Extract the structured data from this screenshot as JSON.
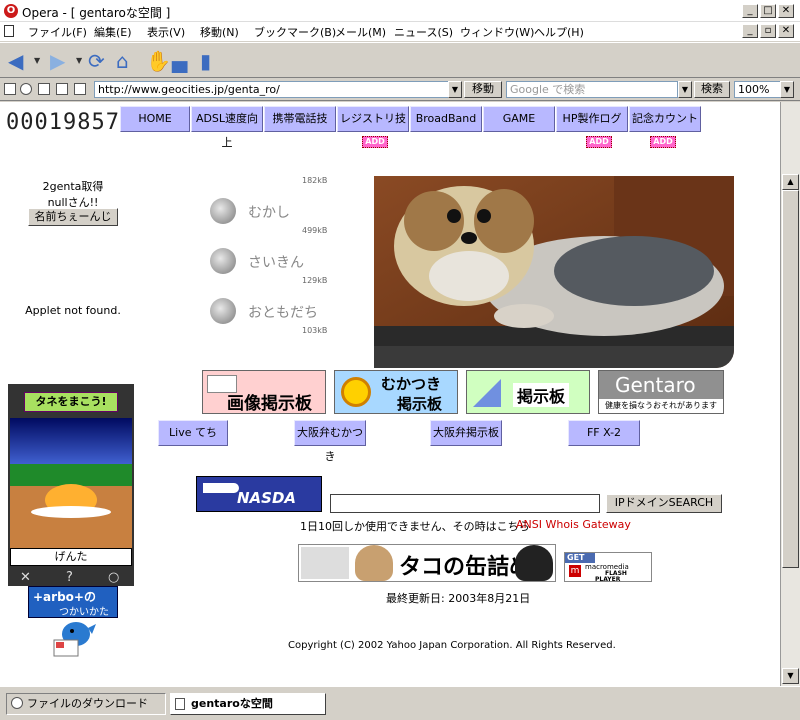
{
  "window": {
    "title": "Opera - [ gentaroな空間 ]"
  },
  "menu": [
    "ファイル(F)",
    "編集(E)",
    "表示(V)",
    "移動(N)",
    "ブックマーク(B)",
    "メール(M)",
    "ニュース(S)",
    "ウィンドウ(W)",
    "ヘルプ(H)"
  ],
  "address": {
    "url": "http://www.geocities.jp/genta_ro/",
    "go_label": "移動",
    "search_placeholder": "Google で検索",
    "search_label": "検索",
    "zoom": "100%"
  },
  "page": {
    "counter": "00019857",
    "nav": [
      "HOME",
      "ADSL速度向上",
      "携帯電話技",
      "レジストリ技",
      "BroadBand",
      "GAME",
      "HP製作ログ",
      "記念カウント"
    ],
    "add_badge": "ADD",
    "left": {
      "line1": "2genta取得",
      "line2": "nullさん!!",
      "name_button": "名前ちぇーんじ",
      "applet": "Applet not found."
    },
    "sounds": [
      {
        "size": "182kB",
        "label": ""
      },
      {
        "size": "499kB",
        "label": "むかし"
      },
      {
        "size": "129kB",
        "label": "さいきん"
      },
      {
        "size": "103kB",
        "label": "おともだち"
      }
    ],
    "banners": {
      "b1": "画像掲示板",
      "b2a": "むかつき",
      "b2b": "掲示板",
      "b3": "掲示板",
      "b4a": "Gentaro",
      "b4b": "健康を損なうおそれがあります"
    },
    "links": [
      "Live てち",
      "大阪弁むかつき",
      "大阪弁掲示板",
      "FF X-2"
    ],
    "tarbo": {
      "label": "タネをまこう!",
      "name": "げんた",
      "ctrl": [
        "✕",
        "?",
        "○"
      ],
      "howto_a": "+arbo+の",
      "howto_b": "つかいかた"
    },
    "nasda": "NASDA",
    "ip_button": "IPドメインSEARCH",
    "ip_note": "1日10回しか使用できません、その時はこちら",
    "ip_link": "ANSI Whois Gateway",
    "kanzume": "タコの缶詰め",
    "flash": {
      "get": "GET",
      "line1": "macromedia",
      "line2": "FLASH",
      "line3": "PLAYER"
    },
    "updated": "最終更新日: 2003年8月21日",
    "copyright": "Copyright (C) 2002 Yahoo Japan Corporation. All Rights Reserved."
  },
  "status": {
    "tab1": "ファイルのダウンロード",
    "tab2": "gentaroな空間"
  }
}
